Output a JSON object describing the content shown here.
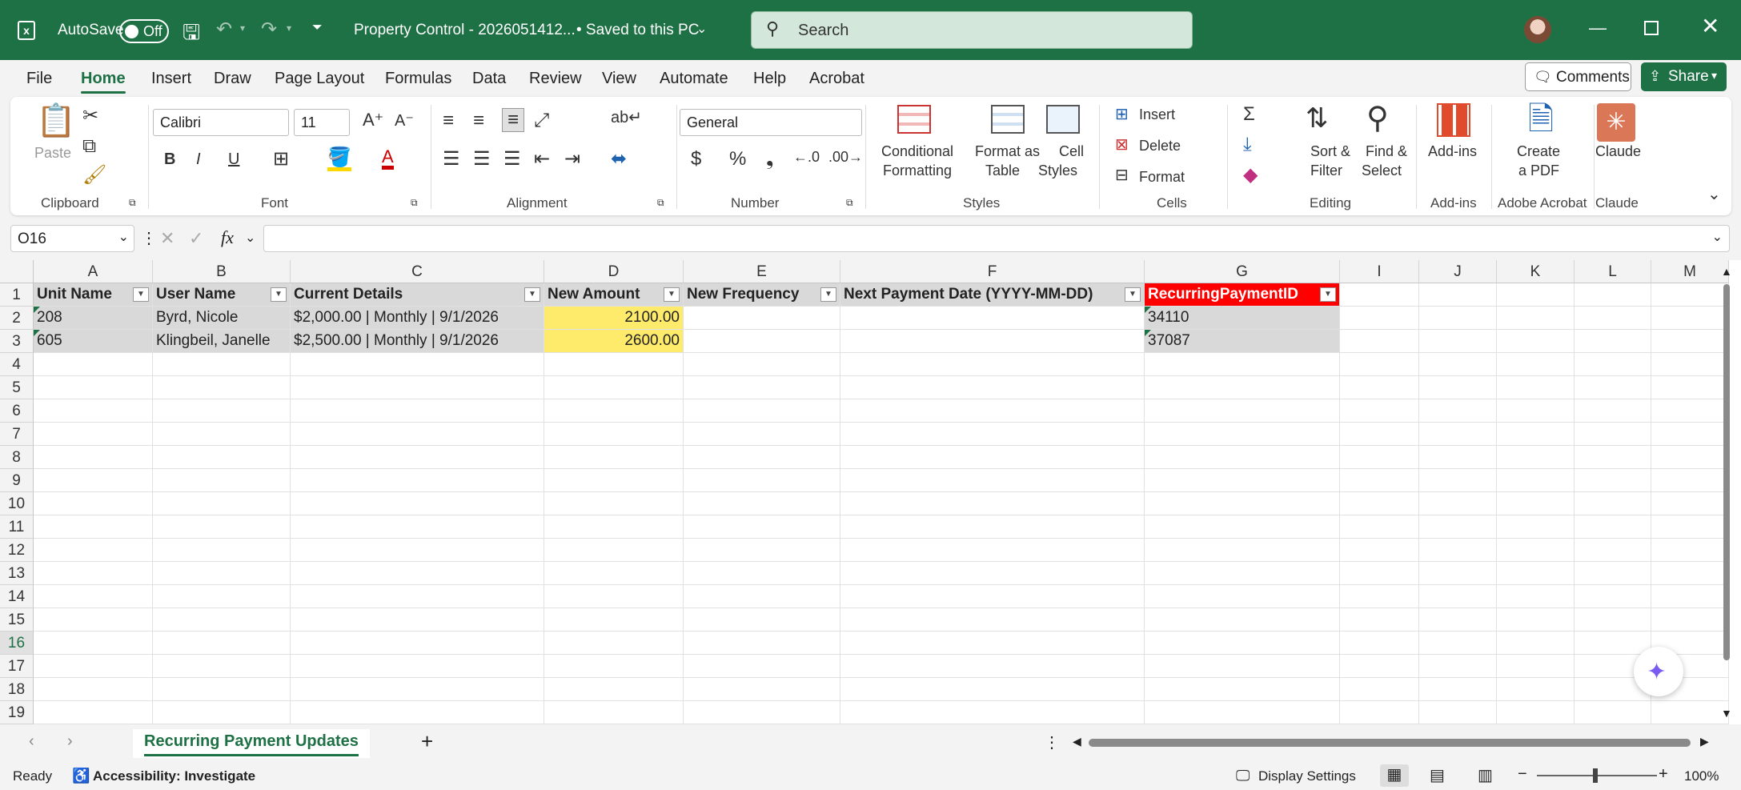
{
  "titlebar": {
    "autosave_label": "AutoSave",
    "autosave_state": "Off",
    "doc_title": "Property Control - 2026051412...",
    "saved_status": "• Saved to this PC",
    "search_placeholder": "Search"
  },
  "menu": {
    "items": [
      "File",
      "Home",
      "Insert",
      "Draw",
      "Page Layout",
      "Formulas",
      "Data",
      "Review",
      "View",
      "Automate",
      "Help",
      "Acrobat"
    ],
    "comments_label": "Comments",
    "share_label": "Share"
  },
  "ribbon": {
    "clipboard": {
      "paste": "Paste",
      "label": "Clipboard"
    },
    "font": {
      "name": "Calibri",
      "size": "11",
      "label": "Font"
    },
    "alignment": {
      "label": "Alignment"
    },
    "number": {
      "format": "General",
      "label": "Number"
    },
    "styles": {
      "conditional": [
        "Conditional",
        "Formatting"
      ],
      "format_table": [
        "Format as",
        "Table"
      ],
      "cell_styles": [
        "Cell",
        "Styles"
      ],
      "label": "Styles"
    },
    "cells": {
      "insert": "Insert",
      "delete": "Delete",
      "format": "Format",
      "label": "Cells"
    },
    "editing": {
      "sort": [
        "Sort &",
        "Filter"
      ],
      "find": [
        "Find &",
        "Select"
      ],
      "label": "Editing"
    },
    "addins": {
      "button": "Add-ins",
      "label": "Add-ins"
    },
    "acrobat": {
      "button": [
        "Create",
        "a PDF"
      ],
      "label": "Adobe Acrobat"
    },
    "claude": {
      "button": "Claude",
      "label": "Claude"
    }
  },
  "formula_bar": {
    "name_box": "O16",
    "fx": "fx",
    "value": ""
  },
  "columns": [
    "A",
    "B",
    "C",
    "D",
    "E",
    "F",
    "G",
    "I",
    "J",
    "K",
    "L",
    "M"
  ],
  "rows": [
    "1",
    "2",
    "3",
    "4",
    "5",
    "6",
    "7",
    "8",
    "9",
    "10",
    "11",
    "12",
    "13",
    "14",
    "15",
    "16",
    "17",
    "18",
    "19"
  ],
  "table": {
    "headers": [
      "Unit Name",
      "User Name",
      "Current Details",
      "New Amount",
      "New Frequency",
      "Next Payment Date (YYYY-MM-DD)",
      "RecurringPaymentID"
    ],
    "rows": [
      [
        "208",
        "Byrd, Nicole",
        "$2,000.00 | Monthly | 9/1/2026",
        "2100.00",
        "",
        "",
        "34110"
      ],
      [
        "605",
        "Klingbeil, Janelle",
        "$2,500.00 | Monthly | 9/1/2026",
        "2600.00",
        "",
        "",
        "37087"
      ]
    ]
  },
  "sheet": {
    "tab_name": "Recurring Payment Updates",
    "add": "+"
  },
  "status": {
    "ready": "Ready",
    "accessibility": "Accessibility: Investigate",
    "display_settings": "Display Settings",
    "zoom": "100%"
  }
}
